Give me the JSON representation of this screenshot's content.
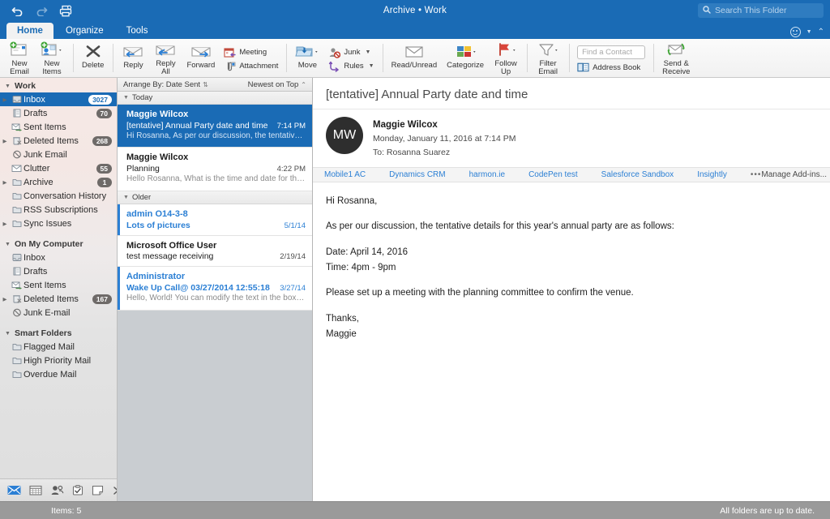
{
  "titlebar": {
    "title": "Archive • Work",
    "undo_icon": "undo-icon",
    "redo_icon": "redo-icon",
    "print_icon": "print-icon",
    "search_placeholder": "Search This Folder",
    "search_value": "",
    "search_icon": "search-icon"
  },
  "tabs": [
    {
      "label": "Home",
      "active": true
    },
    {
      "label": "Organize",
      "active": false
    },
    {
      "label": "Tools",
      "active": false
    }
  ],
  "tabrow_right": {
    "account_icon": "smiley-account-icon",
    "collapse_icon": "chevron-up-icon"
  },
  "ribbon": {
    "new_email": "New\nEmail",
    "new_items": "New\nItems",
    "delete": "Delete",
    "reply": "Reply",
    "reply_all": "Reply\nAll",
    "forward": "Forward",
    "meeting": "Meeting",
    "attachment": "Attachment",
    "move": "Move",
    "junk": "Junk",
    "rules": "Rules",
    "read_unread": "Read/Unread",
    "categorize": "Categorize",
    "follow_up": "Follow\nUp",
    "filter_email": "Filter\nEmail",
    "find_contact_placeholder": "Find a Contact",
    "find_contact_value": "",
    "address_book": "Address Book",
    "send_receive": "Send &\nReceive"
  },
  "sidebar": {
    "sections": [
      {
        "title": "Work",
        "items": [
          {
            "label": "Inbox",
            "badge": "3027",
            "icon": "inbox-icon",
            "disclosure": true,
            "selected": true
          },
          {
            "label": "Drafts",
            "badge": "70",
            "icon": "drafts-icon",
            "disclosure": false,
            "selected": false
          },
          {
            "label": "Sent Items",
            "badge": "",
            "icon": "sent-icon",
            "disclosure": false,
            "selected": false
          },
          {
            "label": "Deleted Items",
            "badge": "268",
            "icon": "deleted-icon",
            "disclosure": true,
            "selected": false
          },
          {
            "label": "Junk Email",
            "badge": "",
            "icon": "junk-icon",
            "disclosure": false,
            "selected": false
          },
          {
            "label": "Clutter",
            "badge": "55",
            "icon": "clutter-icon",
            "disclosure": false,
            "selected": false
          },
          {
            "label": "Archive",
            "badge": "1",
            "icon": "folder-icon",
            "disclosure": true,
            "selected": false
          },
          {
            "label": "Conversation History",
            "badge": "",
            "icon": "folder-icon",
            "disclosure": false,
            "selected": false
          },
          {
            "label": "RSS Subscriptions",
            "badge": "",
            "icon": "folder-icon",
            "disclosure": false,
            "selected": false
          },
          {
            "label": "Sync Issues",
            "badge": "",
            "icon": "folder-icon",
            "disclosure": true,
            "selected": false
          }
        ]
      },
      {
        "title": "On My Computer",
        "items": [
          {
            "label": "Inbox",
            "badge": "",
            "icon": "inbox-icon",
            "disclosure": false,
            "selected": false
          },
          {
            "label": "Drafts",
            "badge": "",
            "icon": "drafts-icon",
            "disclosure": false,
            "selected": false
          },
          {
            "label": "Sent Items",
            "badge": "",
            "icon": "sent-icon",
            "disclosure": false,
            "selected": false
          },
          {
            "label": "Deleted Items",
            "badge": "167",
            "icon": "deleted-icon",
            "disclosure": true,
            "selected": false
          },
          {
            "label": "Junk E-mail",
            "badge": "",
            "icon": "junk-icon",
            "disclosure": false,
            "selected": false
          }
        ]
      },
      {
        "title": "Smart Folders",
        "items": [
          {
            "label": "Flagged Mail",
            "badge": "",
            "icon": "folder-icon",
            "disclosure": false,
            "selected": false
          },
          {
            "label": "High Priority Mail",
            "badge": "",
            "icon": "folder-icon",
            "disclosure": false,
            "selected": false
          },
          {
            "label": "Overdue Mail",
            "badge": "",
            "icon": "folder-icon",
            "disclosure": false,
            "selected": false
          }
        ]
      }
    ],
    "nav_icons": [
      "mail-icon",
      "calendar-icon",
      "people-icon",
      "tasks-icon",
      "notes-icon",
      "chevron-right-icon"
    ]
  },
  "message_list": {
    "arrange_by": "Arrange By: Date Sent",
    "sort_order": "Newest on Top",
    "groups": [
      {
        "title": "Today",
        "messages": [
          {
            "from": "Maggie Wilcox",
            "subject": "[tentative] Annual Party date and time",
            "time": "7:14 PM",
            "preview": "Hi Rosanna, As per our discussion, the tentative detail...",
            "selected": true,
            "unread": false
          },
          {
            "from": "Maggie Wilcox",
            "subject": "Planning",
            "time": "4:22 PM",
            "preview": "Hello Rosanna, What is the time and date for the holid...",
            "selected": false,
            "unread": false
          }
        ]
      },
      {
        "title": "Older",
        "messages": [
          {
            "from": "admin O14-3-8",
            "subject": "Lots of pictures",
            "time": "5/1/14",
            "preview": "",
            "selected": false,
            "unread": true
          },
          {
            "from": "Microsoft Office User",
            "subject": "test message receiving",
            "time": "2/19/14",
            "preview": "",
            "selected": false,
            "unread": false
          },
          {
            "from": "Administrator",
            "subject": "Wake Up Call@ 03/27/2014 12:55:18",
            "time": "3/27/14",
            "preview": "Hello, World! You can modify the text in the box to the...",
            "selected": false,
            "unread": true
          }
        ]
      }
    ]
  },
  "reading_pane": {
    "subject": "[tentative] Annual Party date and time",
    "avatar_initials": "MW",
    "sender": "Maggie Wilcox",
    "date": "Monday, January 11, 2016 at 7:14 PM",
    "to": "To:  Rosanna Suarez",
    "addins": [
      "Mobile1 AC",
      "Dynamics CRM",
      "harmon.ie",
      "CodePen test",
      "Salesforce Sandbox",
      "Insightly"
    ],
    "addins_more": "•••",
    "manage_addins": "Manage Add-ins...",
    "body": {
      "greeting": "Hi Rosanna,",
      "intro": "As per our discussion, the tentative details for this year's annual party are as follows:",
      "date_line": "Date: April 14, 2016",
      "time_line": "Time: 4pm - 9pm",
      "request": "Please set up a meeting with the planning committee to confirm the venue.",
      "signoff": "Thanks,",
      "signature": "Maggie"
    }
  },
  "status_bar": {
    "items_count": "Items: 5",
    "sync_status": "All folders are up to date."
  },
  "colors": {
    "accent_blue": "#1a6bb5",
    "unread_blue": "#2b7fd4",
    "badge_gray": "#6e6a68",
    "status_gray": "#9a9a9a"
  }
}
